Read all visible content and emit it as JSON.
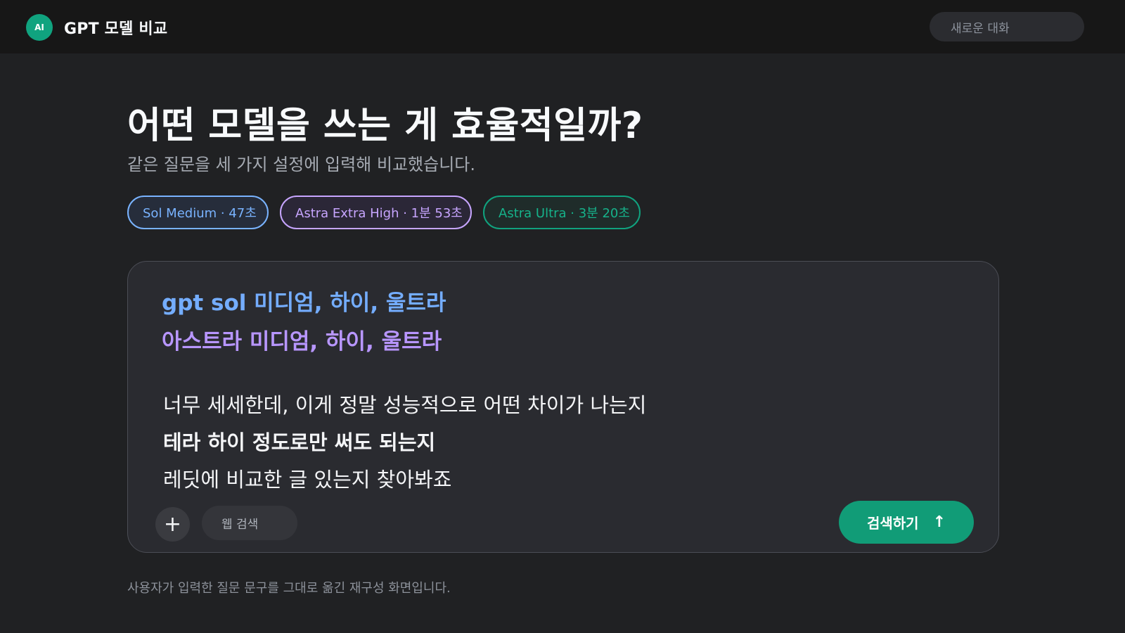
{
  "header": {
    "brand_badge": "AI",
    "title": "GPT 모델 비교",
    "new_chat": "새로운 대화"
  },
  "hero": {
    "title": "어떤 모델을 쓰는 게 효율적일까?",
    "subtitle": "같은 질문을 세 가지 설정에 입력해 비교했습니다."
  },
  "models": [
    {
      "label": "Sol Medium · 47초",
      "color": "#79b3ff"
    },
    {
      "label": "Astra Extra High · 1분 53초",
      "color": "#c7a5ff"
    },
    {
      "label": "Astra Ultra · 3분 20초",
      "color": "#16b28a"
    }
  ],
  "composer": {
    "line_sol": "gpt sol 미디엄, 하이, 울트라",
    "line_astra": "아스트라 미디엄, 하이, 울트라",
    "question_lines": [
      "너무 세세한데, 이게 정말 성능적으로 어떤 차이가 나는지",
      "테라 하이 정도로만 써도 되는지",
      "레딧에 비교한 글 있는지 찾아봐죠"
    ],
    "plus_label": "+",
    "web_search_label": "웹 검색",
    "search_label": "검색하기",
    "search_arrow": "↑"
  },
  "footer": {
    "note": "사용자가 입력한 질문 문구를 그대로 옮긴 재구성 화면입니다."
  },
  "colors": {
    "background": "#202123",
    "topbar": "#171717",
    "accent": "#10a37f"
  }
}
